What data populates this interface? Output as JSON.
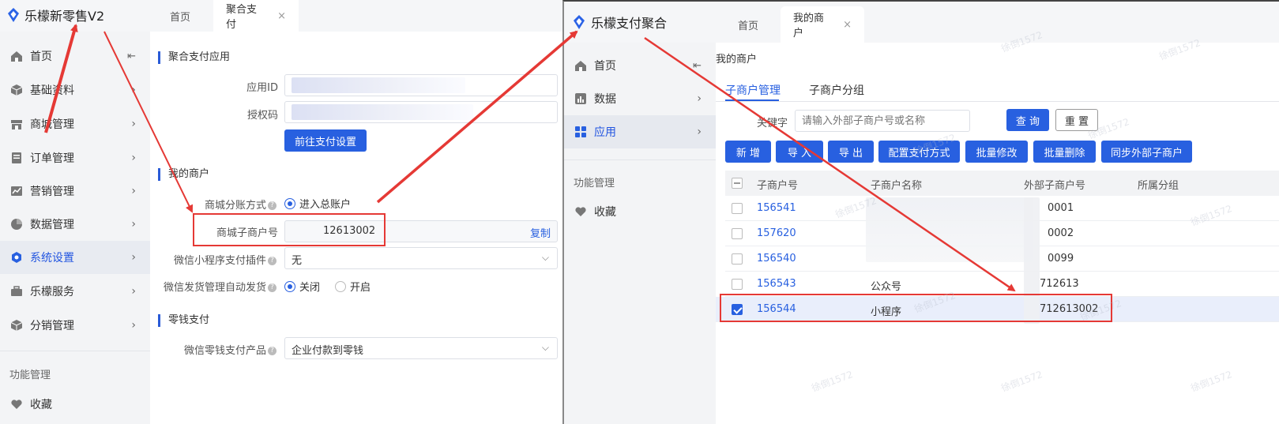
{
  "left_window": {
    "app_title": "乐檬新零售V2",
    "tabs": [
      {
        "label": "首页",
        "active": false,
        "closable": false
      },
      {
        "label": "聚合支付",
        "active": true,
        "closable": true
      }
    ],
    "close_glyph": "×",
    "collapse_glyph": "⇤",
    "sidebar": {
      "items": [
        {
          "label": "首页",
          "icon": "home-icon",
          "has_children": false,
          "active": false
        },
        {
          "label": "基础资料",
          "icon": "box-icon",
          "has_children": true,
          "active": false
        },
        {
          "label": "商城管理",
          "icon": "shop-icon",
          "has_children": true,
          "active": false
        },
        {
          "label": "订单管理",
          "icon": "order-icon",
          "has_children": true,
          "active": false
        },
        {
          "label": "营销管理",
          "icon": "chart-line-icon",
          "has_children": true,
          "active": false
        },
        {
          "label": "数据管理",
          "icon": "pie-icon",
          "has_children": true,
          "active": false
        },
        {
          "label": "系统设置",
          "icon": "gear-hex-icon",
          "has_children": true,
          "active": true
        },
        {
          "label": "乐檬服务",
          "icon": "briefcase-icon",
          "has_children": true,
          "active": false
        },
        {
          "label": "分销管理",
          "icon": "cube-icon",
          "has_children": true,
          "active": false
        }
      ],
      "section_label": "功能管理",
      "favorites_label": "收藏"
    },
    "main": {
      "section_app": "聚合支付应用",
      "app_id_label": "应用ID",
      "auth_code_label": "授权码",
      "goto_pay_settings": "前往支付设置",
      "section_merchant": "我的商户",
      "split_mode_label": "商城分账方式",
      "split_mode_value": "进入总账户",
      "sub_merchant_label": "商城子商户号",
      "sub_merchant_value": "12613002",
      "copy_label": "复制",
      "mini_plugin_label": "微信小程序支付插件",
      "mini_plugin_value": "无",
      "auto_ship_label": "微信发货管理自动发货",
      "auto_ship_off": "关闭",
      "auto_ship_on": "开启",
      "section_change": "零钱支付",
      "change_product_label": "微信零钱支付产品",
      "change_product_value": "企业付款到零钱"
    }
  },
  "right_window": {
    "app_title": "乐檬支付聚合",
    "tabs": [
      {
        "label": "首页",
        "active": false,
        "closable": false
      },
      {
        "label": "我的商户",
        "active": true,
        "closable": true
      }
    ],
    "sidebar": {
      "items": [
        {
          "label": "首页",
          "icon": "home-icon",
          "has_children": false,
          "active": false
        },
        {
          "label": "数据",
          "icon": "bar-chart-icon",
          "has_children": true,
          "active": false
        },
        {
          "label": "应用",
          "icon": "grid-icon",
          "has_children": true,
          "active": true
        }
      ],
      "section_label": "功能管理",
      "favorites_label": "收藏"
    },
    "main": {
      "breadcrumb": "我的商户",
      "subtabs": [
        {
          "label": "子商户管理",
          "active": true
        },
        {
          "label": "子商户分组",
          "active": false
        }
      ],
      "keyword_label": "关键字",
      "keyword_placeholder": "请输入外部子商户号或名称",
      "query_btn": "查 询",
      "reset_btn": "重 置",
      "actions": [
        "新 增",
        "导 入",
        "导 出",
        "配置支付方式",
        "批量修改",
        "批量删除",
        "同步外部子商户"
      ],
      "columns": [
        "子商户号",
        "子商户名称",
        "外部子商户号",
        "所属分组"
      ],
      "rows": [
        {
          "id": "156541",
          "name": "",
          "ext": "0001",
          "checked": false
        },
        {
          "id": "157620",
          "name": "",
          "ext": "0002",
          "checked": false
        },
        {
          "id": "156540",
          "name": "",
          "ext": "0099",
          "checked": false
        },
        {
          "id": "156543",
          "name": "公众号",
          "ext": "712613",
          "checked": false
        },
        {
          "id": "156544",
          "name": "小程序",
          "ext": "712613002",
          "checked": true
        }
      ]
    },
    "watermark_text": "徐倒1572"
  },
  "colors": {
    "primary": "#2860e0",
    "annotation_red": "#e53935",
    "sidebar_bg": "#f3f4f6"
  }
}
